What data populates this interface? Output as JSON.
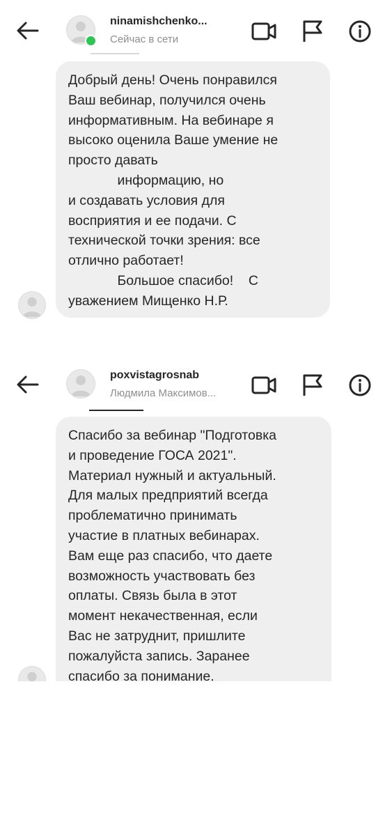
{
  "screenshots": [
    {
      "username": "ninamishchenko...",
      "status": "Сейчас в сети",
      "message": "Добрый день! Очень понравился\nВаш вебинар, получился очень\nинформативным. На вебинаре я\nвысоко оценила Ваше умение не\nпросто давать\n             информацию, но\nи создавать условия для\nвосприятия и ее подачи. С\nтехнической точки зрения: все\nотлично работает!\n             Большое спасибо!    С\nуважением Мищенко Н.Р."
    },
    {
      "username": "poxvistagrosnab",
      "status": "Людмила Максимов...",
      "message": "Спасибо за вебинар \"Подготовка\nи проведение ГОСА 2021\".\nМатериал нужный и актуальный.\nДля малых предприятий всегда\nпроблематично принимать\nучастие в платных вебинарах.\nВам еще раз спасибо, что даете\nвозможность участвовать без\nоплаты. Связь была в этот\nмомент некачественная, если\nВас не затруднит, пришлите\nпожалуйста запись. Заранее\nспасибо за понимание."
    }
  ],
  "icons": [
    "arrow-back-icon",
    "video-call-icon",
    "flag-icon",
    "info-icon",
    "avatar-placeholder-icon"
  ],
  "colors": {
    "bubble": "#efefef",
    "online": "#2dc653",
    "secondary_text": "#8e8e8e",
    "primary_text": "#262626"
  }
}
